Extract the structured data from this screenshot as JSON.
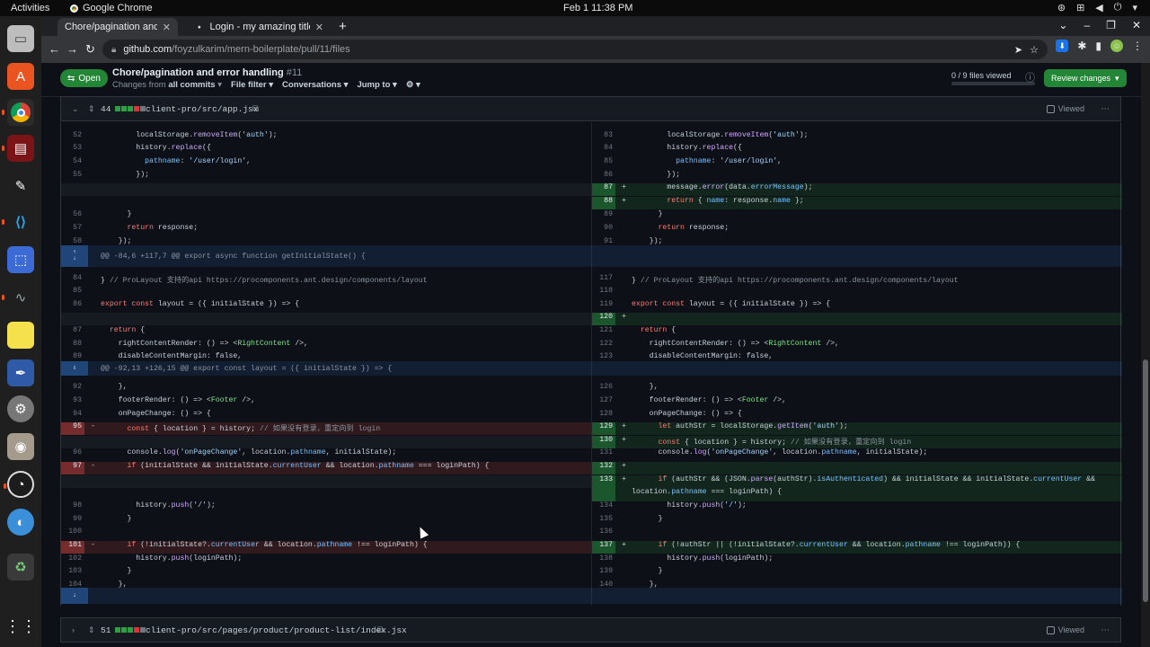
{
  "topbar": {
    "activities": "Activities",
    "app": "Google Chrome",
    "clock": "Feb 1  11:38 PM"
  },
  "tabs": [
    {
      "title": "Chore/pagination and err",
      "active": true,
      "favicon": "github-icon"
    },
    {
      "title": "Login - my amazing title",
      "active": false,
      "favicon": "page-icon"
    }
  ],
  "omnibox": {
    "host": "github.com",
    "path": "/foyzulkarim/mern-boilerplate/pull/11/files"
  },
  "pr": {
    "state": "Open",
    "title": "Chore/pagination and error handling",
    "number": "#11",
    "changes_from_prefix": "Changes from",
    "changes_from": "all commits",
    "file_filter": "File filter",
    "conversations": "Conversations",
    "jump_to": "Jump to",
    "files_viewed": "0 / 9 files viewed",
    "review_button": "Review changes"
  },
  "file1": {
    "count": "44",
    "name": "client-pro/src/app.jsx",
    "viewed": "Viewed"
  },
  "file2": {
    "count": "51",
    "name": "client-pro/src/pages/product/product-list/index.jsx",
    "viewed": "Viewed"
  },
  "hunks": [
    "@@ -84,6 +117,7 @@ export async function getInitialState() {",
    "@@ -92,13 +126,15 @@ export const layout = ({ initialState }) => {"
  ],
  "left_lines": [
    {
      "ln": "52",
      "code": "        localStorage.removeItem('auth');"
    },
    {
      "ln": "53",
      "code": "        history.replace({"
    },
    {
      "ln": "54",
      "code": "          pathname: '/user/login',"
    },
    {
      "ln": "55",
      "code": "        });"
    },
    {
      "ln": "56",
      "code": "      }"
    },
    {
      "ln": "57",
      "code": "      return response;"
    },
    {
      "ln": "58",
      "code": "    });"
    },
    {
      "ln": "84",
      "code": "} // ProLayout 支持的api https://procomponents.ant.design/components/layout"
    },
    {
      "ln": "85",
      "code": ""
    },
    {
      "ln": "86",
      "code": "export const layout = ({ initialState }) => {"
    },
    {
      "ln": "87",
      "code": "  return {"
    },
    {
      "ln": "88",
      "code": "    rightContentRender: () => <RightContent />,"
    },
    {
      "ln": "89",
      "code": "    disableContentMargin: false,"
    },
    {
      "ln": "92",
      "code": "    },"
    },
    {
      "ln": "93",
      "code": "    footerRender: () => <Footer />,"
    },
    {
      "ln": "94",
      "code": "    onPageChange: () => {"
    },
    {
      "ln": "95",
      "code": "      const { location } = history; // 如果没有登录，重定向到 login"
    },
    {
      "ln": "96",
      "code": "      console.log('onPageChange', location.pathname, initialState);"
    },
    {
      "ln": "97",
      "code": "      if (initialState && initialState.currentUser && location.pathname === loginPath) {"
    },
    {
      "ln": "98",
      "code": "        history.push('/');"
    },
    {
      "ln": "99",
      "code": "      }"
    },
    {
      "ln": "100",
      "code": ""
    },
    {
      "ln": "101",
      "code": "      if (!initialState?.currentUser && location.pathname !== loginPath) {"
    },
    {
      "ln": "102",
      "code": "        history.push(loginPath);"
    },
    {
      "ln": "103",
      "code": "      }"
    },
    {
      "ln": "104",
      "code": "    },"
    }
  ],
  "right_lines": [
    {
      "ln": "83",
      "code": "        localStorage.removeItem('auth');"
    },
    {
      "ln": "84",
      "code": "        history.replace({"
    },
    {
      "ln": "85",
      "code": "          pathname: '/user/login',"
    },
    {
      "ln": "86",
      "code": "        });"
    },
    {
      "ln": "87",
      "code": "        message.error(data.errorMessage);"
    },
    {
      "ln": "88",
      "code": "        return { name: response.name };"
    },
    {
      "ln": "89",
      "code": "      }"
    },
    {
      "ln": "90",
      "code": "      return response;"
    },
    {
      "ln": "91",
      "code": "    });"
    },
    {
      "ln": "117",
      "code": "} // ProLayout 支持的api https://procomponents.ant.design/components/layout"
    },
    {
      "ln": "118",
      "code": ""
    },
    {
      "ln": "119",
      "code": "export const layout = ({ initialState }) => {"
    },
    {
      "ln": "120",
      "code": ""
    },
    {
      "ln": "121",
      "code": "  return {"
    },
    {
      "ln": "122",
      "code": "    rightContentRender: () => <RightContent />,"
    },
    {
      "ln": "123",
      "code": "    disableContentMargin: false,"
    },
    {
      "ln": "126",
      "code": "    },"
    },
    {
      "ln": "127",
      "code": "    footerRender: () => <Footer />,"
    },
    {
      "ln": "128",
      "code": "    onPageChange: () => {"
    },
    {
      "ln": "129",
      "code": "      let authStr = localStorage.getItem('auth');"
    },
    {
      "ln": "130",
      "code": "      const { location } = history; // 如果没有登录，重定向到 login"
    },
    {
      "ln": "131",
      "code": "      console.log('onPageChange', location.pathname, initialState);"
    },
    {
      "ln": "132",
      "code": ""
    },
    {
      "ln": "133",
      "code": "      if (authStr && (JSON.parse(authStr).isAuthenticated) && initialState && initialState.currentUser &&"
    },
    {
      "ln": "133b",
      "code": "location.pathname === loginPath) {"
    },
    {
      "ln": "134",
      "code": "        history.push('/');"
    },
    {
      "ln": "135",
      "code": "      }"
    },
    {
      "ln": "136",
      "code": ""
    },
    {
      "ln": "137",
      "code": "      if (!authStr || (!initialState?.currentUser && location.pathname !== loginPath)) {"
    },
    {
      "ln": "138",
      "code": "        history.push(loginPath);"
    },
    {
      "ln": "139",
      "code": "      }"
    },
    {
      "ln": "140",
      "code": "    },"
    }
  ]
}
